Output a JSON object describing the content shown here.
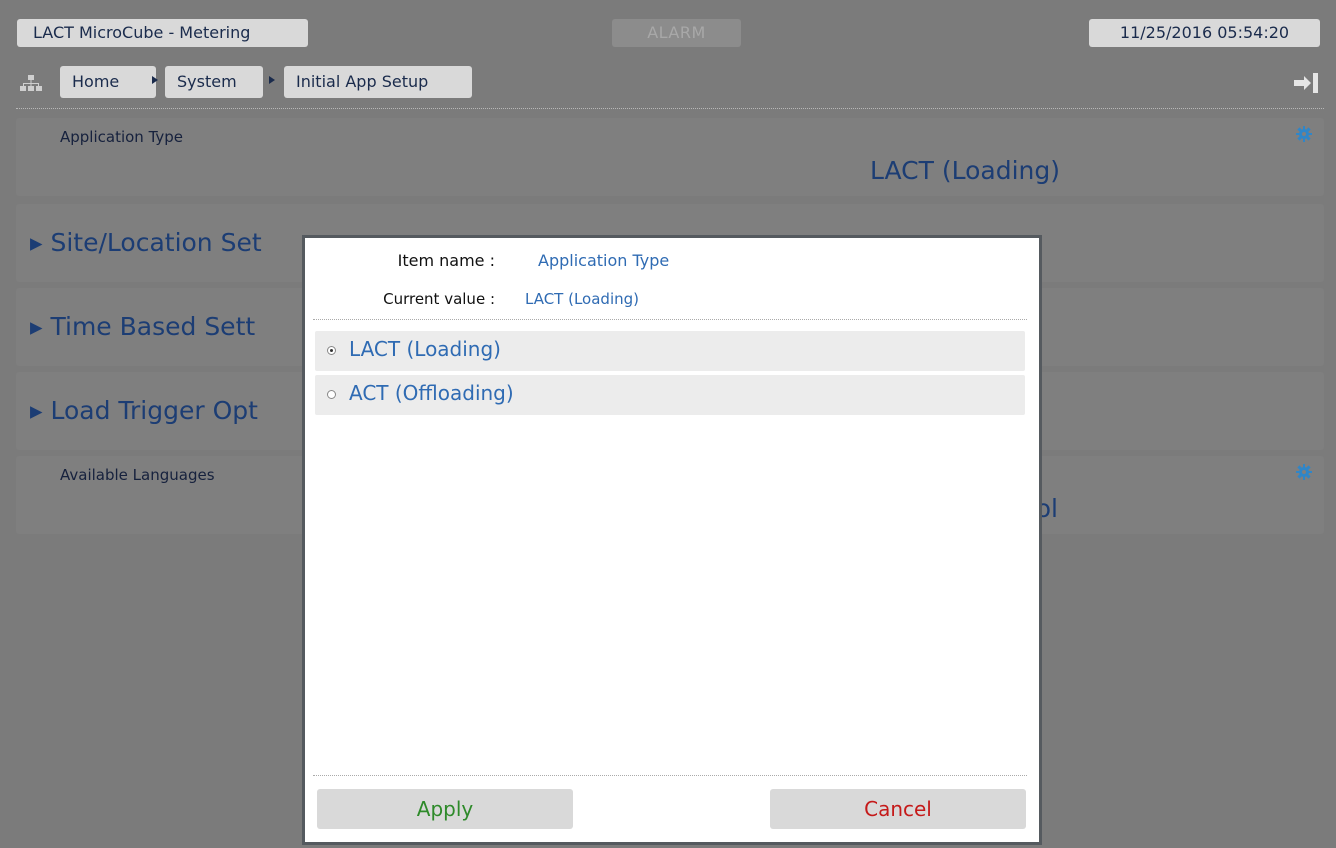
{
  "topbar": {
    "app_title": "LACT MicroCube - Metering",
    "alarm": "ALARM",
    "datetime": "11/25/2016 05:54:20"
  },
  "breadcrumb": {
    "items": [
      {
        "label": "Home"
      },
      {
        "label": "System"
      },
      {
        "label": "Initial App Setup"
      }
    ]
  },
  "panels": {
    "application_type": {
      "label": "Application Type",
      "value": "LACT (Loading)"
    },
    "site_location": {
      "label": "▸ Site/Location Set"
    },
    "time_based": {
      "label": "▸ Time Based Sett"
    },
    "load_trigger": {
      "label": "▸ Load Trigger Opt"
    },
    "available_languages": {
      "label": "Available Languages",
      "value": "ol"
    }
  },
  "modal": {
    "item_name_label": "Item name :",
    "item_name_value": "Application Type",
    "current_value_label": "Current value :",
    "current_value_value": "LACT (Loading)",
    "options": [
      {
        "label": "LACT (Loading)",
        "selected": true
      },
      {
        "label": "ACT (Offloading)",
        "selected": false
      }
    ],
    "apply_label": "Apply",
    "cancel_label": "Cancel"
  },
  "colors": {
    "accent_blue": "#2f6bb3",
    "apply_green": "#2e8a2a",
    "cancel_red": "#c51a1a",
    "gear_blue": "#2f86c9"
  },
  "icons": {
    "tree": "sitemap-icon",
    "logout": "logout-icon",
    "gear": "gear-icon"
  }
}
